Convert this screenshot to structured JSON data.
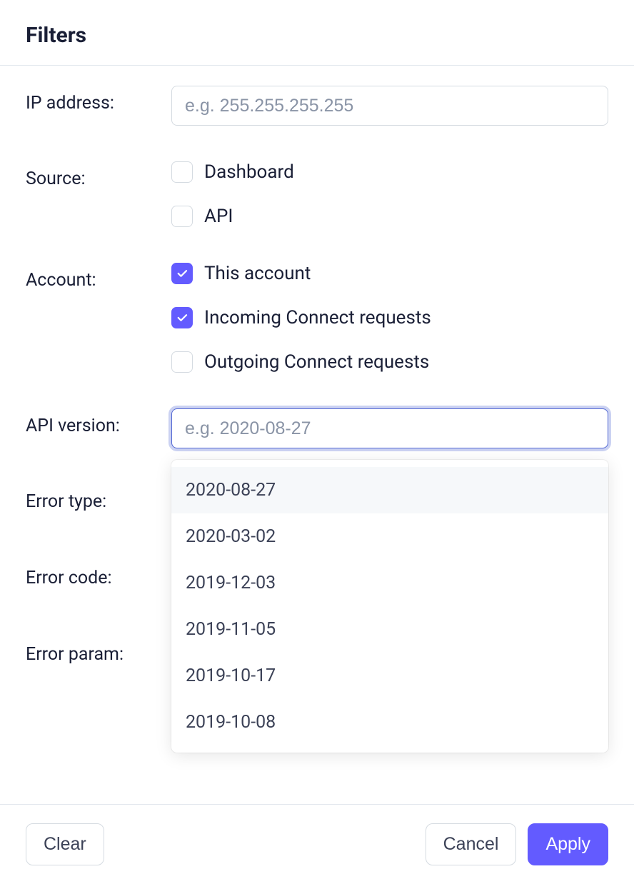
{
  "header": {
    "title": "Filters"
  },
  "fields": {
    "ip_address": {
      "label": "IP address:",
      "placeholder": "e.g. 255.255.255.255",
      "value": ""
    },
    "source": {
      "label": "Source:",
      "options": [
        {
          "label": "Dashboard",
          "checked": false
        },
        {
          "label": "API",
          "checked": false
        }
      ]
    },
    "account": {
      "label": "Account:",
      "options": [
        {
          "label": "This account",
          "checked": true
        },
        {
          "label": "Incoming Connect requests",
          "checked": true
        },
        {
          "label": "Outgoing Connect requests",
          "checked": false
        }
      ]
    },
    "api_version": {
      "label": "API version:",
      "placeholder": "e.g. 2020-08-27",
      "value": "",
      "dropdown": {
        "open": true,
        "highlighted_index": 0,
        "options": [
          "2020-08-27",
          "2020-03-02",
          "2019-12-03",
          "2019-11-05",
          "2019-10-17",
          "2019-10-08"
        ]
      }
    },
    "error_type": {
      "label": "Error type:"
    },
    "error_code": {
      "label": "Error code:"
    },
    "error_param": {
      "label": "Error param:"
    }
  },
  "footer": {
    "clear": "Clear",
    "cancel": "Cancel",
    "apply": "Apply"
  },
  "colors": {
    "accent": "#635bff",
    "focus_ring": "rgba(84,105,212,0.3)",
    "border": "#d5dbe1"
  }
}
